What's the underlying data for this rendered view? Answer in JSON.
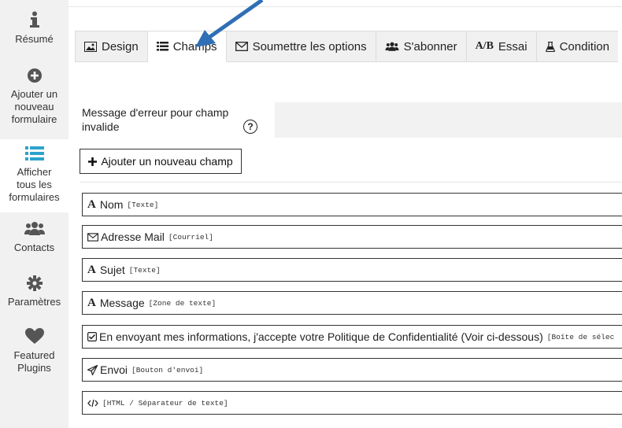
{
  "sidebar": {
    "items": [
      {
        "label": "Résumé",
        "icon": "info-icon"
      },
      {
        "label": "Ajouter un nouveau formulaire",
        "icon": "plus-circle-icon"
      },
      {
        "label": "Afficher tous les formulaires",
        "icon": "list-icon"
      },
      {
        "label": "Contacts",
        "icon": "users-icon"
      },
      {
        "label": "Paramètres",
        "icon": "gear-icon"
      },
      {
        "label": "Featured Plugins",
        "icon": "heart-icon"
      }
    ],
    "active_index": 2,
    "accent": "#2ea2cc"
  },
  "tabs": [
    {
      "label": "Design",
      "icon": "image-icon"
    },
    {
      "label": "Champs",
      "icon": "list-icon"
    },
    {
      "label": "Soumettre les options",
      "icon": "envelope-icon"
    },
    {
      "label": "S'abonner",
      "icon": "users-icon"
    },
    {
      "label": "Essai",
      "icon_text": "A/B"
    },
    {
      "label": "Condition",
      "icon": "flask-icon"
    }
  ],
  "active_tab": "Champs",
  "error_message": {
    "label": "Message d'erreur pour champ invalide",
    "help": "?",
    "value": ""
  },
  "add_field_button": "Ajouter un nouveau champ",
  "fields": [
    {
      "label": "Nom",
      "type": "[Texte]",
      "icon": "text-icon"
    },
    {
      "label": "Adresse Mail",
      "type": "[Courriel]",
      "icon": "envelope-icon"
    },
    {
      "label": "Sujet",
      "type": "[Texte]",
      "icon": "text-icon"
    },
    {
      "label": "Message",
      "type": "[Zone de texte]",
      "icon": "text-icon"
    },
    {
      "label": "En envoyant mes informations, j'accepte votre Politique de Confidentialité (Voir ci-dessous)",
      "type": "[Boîte de sélec",
      "icon": "checkbox-icon"
    },
    {
      "label": "Envoi",
      "type": "[Bouton d'envoi]",
      "icon": "send-icon"
    },
    {
      "label": "",
      "type": "[HTML / Séparateur de texte]",
      "icon": "code-icon"
    }
  ],
  "annotation_arrow_color": "#2f6fb5"
}
